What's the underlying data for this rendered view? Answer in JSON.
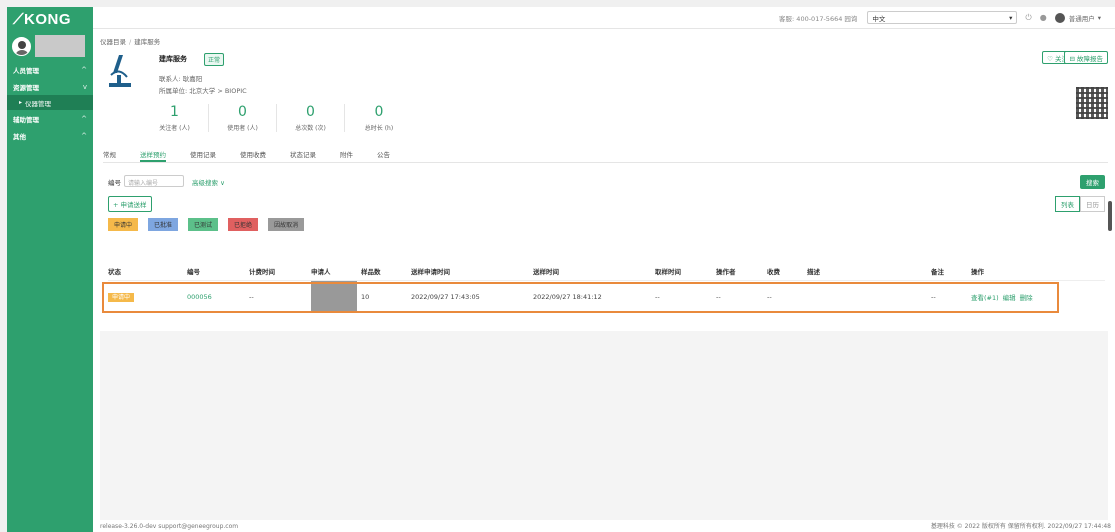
{
  "app": {
    "logo": "KONG"
  },
  "sidebar": {
    "items": [
      {
        "label": "人员管理",
        "chevron": "^"
      },
      {
        "label": "资源管理",
        "chevron": "v"
      },
      {
        "label": "仪器管理",
        "sub": true
      },
      {
        "label": "辅助管理",
        "chevron": "^"
      },
      {
        "label": "其他",
        "chevron": "^"
      }
    ]
  },
  "topbar": {
    "phone": "客服: 400-017-5664 园询",
    "language": "中文",
    "user": "普通用户"
  },
  "breadcrumb": {
    "parent": "仪器目录",
    "sep": "/",
    "current": "建库服务"
  },
  "instrument": {
    "title": "建库服务",
    "status": "正常",
    "contact": "联系人: 耿嘉阳",
    "dept": "所属单位: 北京大学 > BIOPIC",
    "follow_label": "♡ 关注",
    "report_label": "⊟ 故障报告"
  },
  "stats": [
    {
      "num": "1",
      "label": "关注者 (人)"
    },
    {
      "num": "0",
      "label": "使用者 (人)"
    },
    {
      "num": "0",
      "label": "总次数 (次)"
    },
    {
      "num": "0",
      "label": "总时长 (h)"
    }
  ],
  "tabs": [
    {
      "label": "常规",
      "active": false
    },
    {
      "label": "送样预约",
      "active": true
    },
    {
      "label": "使用记录",
      "active": false
    },
    {
      "label": "使用收费",
      "active": false
    },
    {
      "label": "状态记录",
      "active": false
    },
    {
      "label": "附件",
      "active": false
    },
    {
      "label": "公告",
      "active": false
    }
  ],
  "filter": {
    "label": "编号",
    "placeholder": "请输入编号",
    "advanced": "高级搜索 ∨",
    "search_button": "搜索",
    "apply_button": "+ 申请送样",
    "view_list": "列表",
    "view_calendar": "日历"
  },
  "legend": [
    {
      "label": "申请中",
      "color": "#f5b94a"
    },
    {
      "label": "已批准",
      "color": "#7ea6e0"
    },
    {
      "label": "已测试",
      "color": "#5cc08a"
    },
    {
      "label": "已拒绝",
      "color": "#e06060"
    },
    {
      "label": "因故取消",
      "color": "#9a9a9a"
    }
  ],
  "table": {
    "headers": [
      "状态",
      "编号",
      "计费时间",
      "申请人",
      "样品数",
      "送样申请时间",
      "送样时间",
      "取样时间",
      "操作者",
      "收费",
      "描述",
      "备注",
      "操作"
    ],
    "rows": [
      {
        "status": "申请中",
        "code": "000056",
        "billing_time": "--",
        "applicant": "",
        "samples": "10",
        "apply_time": "2022/09/27 17:43:05",
        "send_time": "2022/09/27 18:41:12",
        "pickup_time": "--",
        "operator": "--",
        "fee": "--",
        "desc": "",
        "note": "--",
        "ops": [
          "查看(#1)",
          "编辑",
          "删除"
        ]
      }
    ]
  },
  "footer": {
    "left": "release-3.26.0-dev   support@geneegroup.com",
    "right": "基理科技 © 2022 版权所有 保留所有权利. 2022/09/27 17:44:48"
  }
}
